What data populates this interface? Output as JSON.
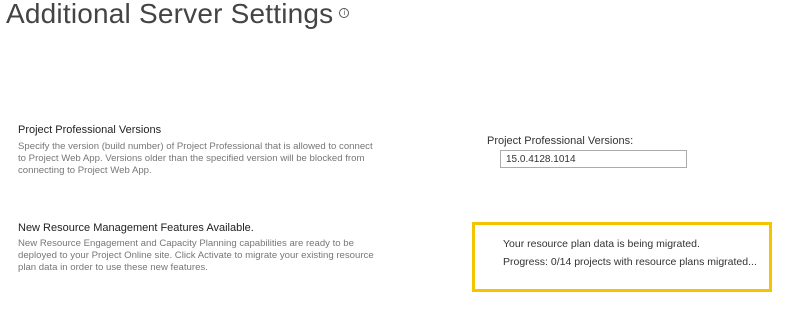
{
  "page": {
    "title": "Additional Server Settings",
    "info_icon_glyph": "i"
  },
  "project_professional": {
    "heading": "Project Professional Versions",
    "description": "Specify the version (build number) of Project Professional that is allowed to connect to Project Web App. Versions older than the specified version will be blocked from connecting to Project Web App.",
    "field_label": "Project Professional Versions:",
    "field_value": "15.0.4128.1014"
  },
  "resource_management": {
    "heading": "New Resource Management Features Available.",
    "description": "New Resource Engagement and Capacity Planning capabilities are ready to be deployed to your Project Online site. Click Activate to migrate your existing resource plan data in order to use these new features.",
    "status_message": "Your resource plan data is being migrated.",
    "progress_message": "Progress: 0/14 projects with resource plans migrated...",
    "highlight_color": "#f2c500"
  }
}
